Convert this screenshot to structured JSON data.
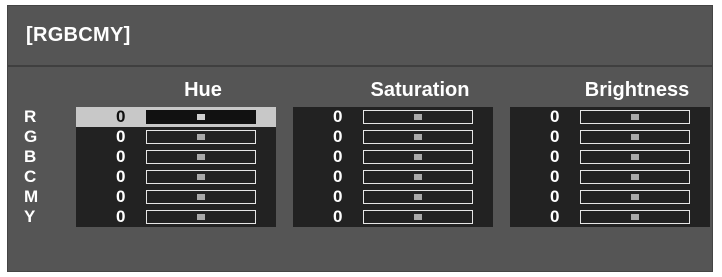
{
  "panel": {
    "title": "[RGBCMY]"
  },
  "columns": [
    {
      "key": "hue",
      "label": "Hue"
    },
    {
      "key": "saturation",
      "label": "Saturation"
    },
    {
      "key": "brightness",
      "label": "Brightness"
    }
  ],
  "rows": [
    {
      "label": "R",
      "hue": "0",
      "saturation": "0",
      "brightness": "0",
      "hue_level": 0.5,
      "saturation_level": 0.5,
      "brightness_level": 0.5
    },
    {
      "label": "G",
      "hue": "0",
      "saturation": "0",
      "brightness": "0",
      "hue_level": 0.5,
      "saturation_level": 0.5,
      "brightness_level": 0.5
    },
    {
      "label": "B",
      "hue": "0",
      "saturation": "0",
      "brightness": "0",
      "hue_level": 0.5,
      "saturation_level": 0.5,
      "brightness_level": 0.5
    },
    {
      "label": "C",
      "hue": "0",
      "saturation": "0",
      "brightness": "0",
      "hue_level": 0.5,
      "saturation_level": 0.5,
      "brightness_level": 0.5
    },
    {
      "label": "M",
      "hue": "0",
      "saturation": "0",
      "brightness": "0",
      "hue_level": 0.5,
      "saturation_level": 0.5,
      "brightness_level": 0.5
    },
    {
      "label": "Y",
      "hue": "0",
      "saturation": "0",
      "brightness": "0",
      "hue_level": 0.5,
      "saturation_level": 0.5,
      "brightness_level": 0.5
    }
  ],
  "selected": {
    "row": "R",
    "column": "hue"
  },
  "colors": {
    "panel_bg": "#555555",
    "cell_bg": "#222222",
    "selected_bg": "#c8c8c8",
    "text": "#ffffff"
  }
}
